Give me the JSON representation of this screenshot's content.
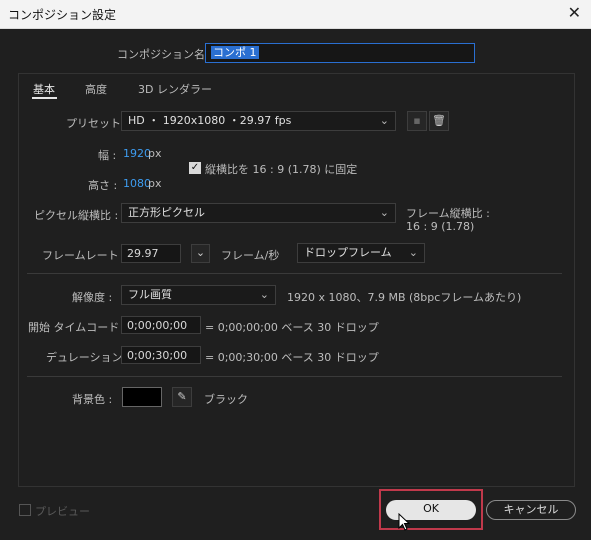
{
  "window": {
    "title": "コンポジション設定",
    "close": "✕"
  },
  "name": {
    "label": "コンポジション名 :",
    "value": "コンポ 1"
  },
  "tabs": [
    "基本",
    "高度",
    "3D レンダラー"
  ],
  "preset": {
    "label": "プリセット :",
    "value": "HD ・ 1920x1080 ・29.97 fps"
  },
  "width": {
    "label": "幅 :",
    "value": "1920",
    "unit": "px"
  },
  "height": {
    "label": "高さ :",
    "value": "1080",
    "unit": "px"
  },
  "aspect_lock": {
    "checked": true,
    "label": "縦横比を 16 : 9 (1.78) に固定"
  },
  "pixel_aspect": {
    "label": "ピクセル縦横比 :",
    "value": "正方形ピクセル"
  },
  "frame_aspect": {
    "label": "フレーム縦横比 :",
    "value": "16 : 9 (1.78)"
  },
  "frame_rate": {
    "label": "フレームレート :",
    "value": "29.97",
    "unit": "フレーム/秒",
    "mode": "ドロップフレーム"
  },
  "resolution": {
    "label": "解像度 :",
    "value": "フル画質",
    "info": "1920 x 1080、7.9 MB (8bpcフレームあたり)"
  },
  "start_tc": {
    "label": "開始 タイムコード :",
    "value": "0;00;00;00",
    "info": "= 0;00;00;00  ベース 30  ドロップ"
  },
  "duration": {
    "label": "デュレーション :",
    "value": "0;00;30;00",
    "info": "= 0;00;30;00  ベース 30  ドロップ"
  },
  "bg": {
    "label": "背景色 :",
    "color": "#000000",
    "name": "ブラック"
  },
  "footer": {
    "preview": "プレビュー",
    "ok": "OK",
    "cancel": "キャンセル"
  },
  "colors": {
    "accent": "#3d9cf0",
    "highlight": "#c0394b"
  }
}
